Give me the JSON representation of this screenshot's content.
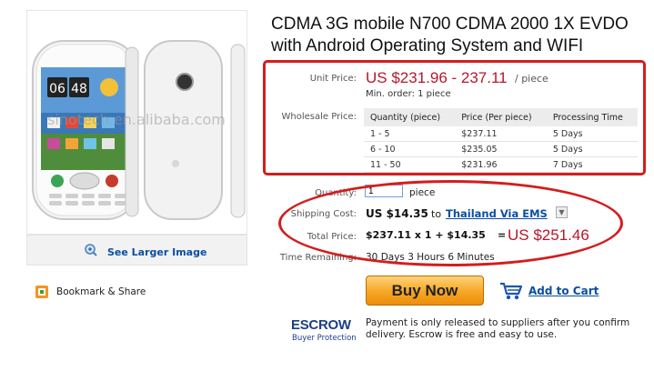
{
  "image_panel": {
    "watermark": "sinotech.en.alibaba.com",
    "phone_time_h": "06",
    "phone_time_m": "48",
    "larger_image_label": "See Larger Image"
  },
  "bookmark_label": "Bookmark & Share",
  "title": "CDMA 3G mobile N700 CDMA 2000 1X EVDO with Android Operating System and WIFI",
  "pricing": {
    "unit_price_label": "Unit Price:",
    "unit_price": "US $231.96 - 237.11",
    "unit_suffix": "/ piece",
    "min_order": "Min. order: 1 piece",
    "wholesale_label": "Wholesale Price:",
    "table_headers": [
      "Quantity (piece)",
      "Price (Per piece)",
      "Processing Time"
    ],
    "table_rows": [
      [
        "1 - 5",
        "$237.11",
        "5 Days"
      ],
      [
        "6 - 10",
        "$235.05",
        "5 Days"
      ],
      [
        "11 - 50",
        "$231.96",
        "7 Days"
      ]
    ]
  },
  "order": {
    "quantity_label": "Quantity:",
    "quantity_value": "1",
    "quantity_unit": "piece",
    "shipping_label": "Shipping Cost:",
    "shipping_cost": "US $14.35",
    "shipping_to": "to",
    "shipping_dest": "Thailand Via EMS",
    "total_label": "Total Price:",
    "total_calc": "$237.11 x 1 + $14.35",
    "total_eq": "=",
    "total_price": "US $251.46",
    "time_label": "Time Remaining:",
    "time_value": "30 Days 3 Hours 6 Minutes"
  },
  "actions": {
    "buy_now": "Buy Now",
    "add_to_cart": "Add to Cart"
  },
  "escrow": {
    "logo": "ESCROW",
    "sub": "Buyer Protection",
    "note": "Payment is only released to suppliers after you confirm delivery. Escrow is free and easy to use."
  },
  "colors": {
    "price_red": "#b7172b",
    "link_blue": "#0b4ea2",
    "annotation_red": "#d41d1d",
    "button_orange": "#f6a623"
  }
}
